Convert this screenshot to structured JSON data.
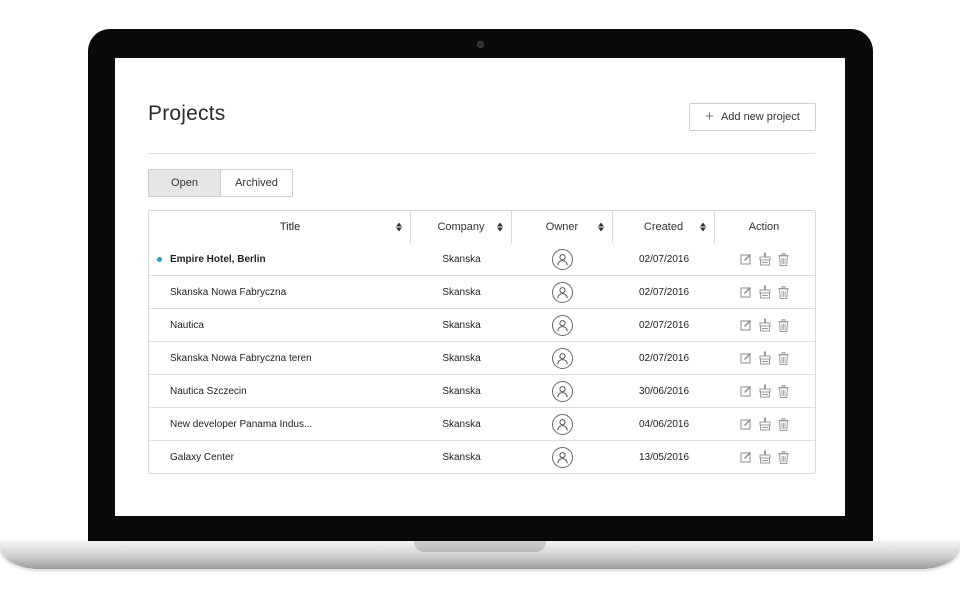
{
  "header": {
    "title": "Projects",
    "add_button_label": "Add new project"
  },
  "tabs": [
    {
      "label": "Open",
      "active": true
    },
    {
      "label": "Archived",
      "active": false
    }
  ],
  "table": {
    "columns": [
      "Title",
      "Company",
      "Owner",
      "Created",
      "Action"
    ],
    "rows": [
      {
        "title": "Empire Hotel, Berlin",
        "company": "Skanska",
        "created": "02/07/2016",
        "highlighted": true
      },
      {
        "title": "Skanska Nowa Fabryczna",
        "company": "Skanska",
        "created": "02/07/2016"
      },
      {
        "title": "Nautica",
        "company": "Skanska",
        "created": "02/07/2016"
      },
      {
        "title": "Skanska Nowa Fabryczna teren",
        "company": "Skanska",
        "created": "02/07/2016"
      },
      {
        "title": "Nautica Szczecin",
        "company": "Skanska",
        "created": "30/06/2016"
      },
      {
        "title": "New developer Panama Indus...",
        "company": "Skanska",
        "created": "04/06/2016"
      },
      {
        "title": "Galaxy Center",
        "company": "Skanska",
        "created": "13/05/2016"
      }
    ]
  },
  "icons": {
    "add": "plus-icon",
    "sort": "sort-icon",
    "owner": "user-avatar-icon",
    "edit": "edit-icon",
    "archive": "archive-icon",
    "delete": "trash-icon"
  },
  "colors": {
    "unread_dot": "#2a9fc6",
    "active_tab": "#e6e6e6"
  }
}
